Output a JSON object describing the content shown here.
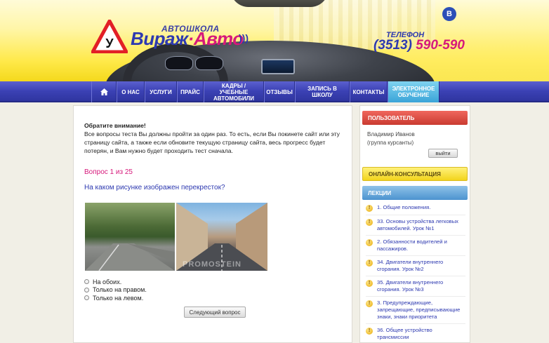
{
  "header": {
    "logo_sign": "У",
    "logo_small": "АВТОШКОЛА",
    "logo_part1": "Вираж",
    "logo_part2": "Авто",
    "logo_sep": "·",
    "phone_label": "ТЕЛЕФОН",
    "phone_code": "(3513)",
    "phone_number": "590-590",
    "social_label": "В"
  },
  "nav": {
    "items": [
      {
        "label": ""
      },
      {
        "label": "О НАС"
      },
      {
        "label": "УСЛУГИ"
      },
      {
        "label": "ПРАЙС"
      },
      {
        "label": "КАДРЫ / УЧЕБНЫЕ АВТОМОБИЛИ"
      },
      {
        "label": "ОТЗЫВЫ"
      },
      {
        "label": "ЗАПИСЬ В ШКОЛУ"
      },
      {
        "label": "КОНТАКТЫ"
      },
      {
        "label": "ЭЛЕКТРОННОЕ ОБУЧЕНИЕ"
      }
    ]
  },
  "main": {
    "notice_title": "Обратите внимание!",
    "notice_text": "Все вопросы теста Вы должны пройти за один раз. То есть, если Вы покинете сайт или эту страницу сайта, а также если обновите текущую страницу сайта, весь прогресс будет потерян, и Вам нужно будет проходить тест сначала.",
    "question_counter": "Вопрос 1 из 25",
    "question_text": "На каком рисунке изображен перекресток?",
    "watermark": "PROMOSTEIN",
    "options": [
      "На обоих.",
      "Только на правом.",
      "Только на левом."
    ],
    "next_button": "Следующий вопрос"
  },
  "sidebar": {
    "user_header": "ПОЛЬЗОВАТЕЛЬ",
    "user_name": "Владимир Иванов",
    "user_group": "(группа курсанты)",
    "logout_button": "выйти",
    "consult_header": "ОНЛАЙН-КОНСУЛЬТАЦИЯ",
    "lectures_header": "ЛЕКЦИИ",
    "lectures": [
      "1. Общие положения.",
      "33. Основы устройства легковых автомобилей. Урок №1",
      "2. Обязанности водителей и пассажиров.",
      "34. Двигатели внутреннего сгорания. Урок №2",
      "35. Двигатели внутреннего сгорания. Урок №3",
      "3. Предупреждающие, запрещающие, предписывающие знаки, знаки приоритета",
      "36. Общее устройство трансмиссии"
    ]
  },
  "colors": {
    "accent_blue": "#2d39b0",
    "accent_pink": "#d6197b",
    "nav_bg": "#3b41b4",
    "header_yellow": "#ffe94a"
  }
}
